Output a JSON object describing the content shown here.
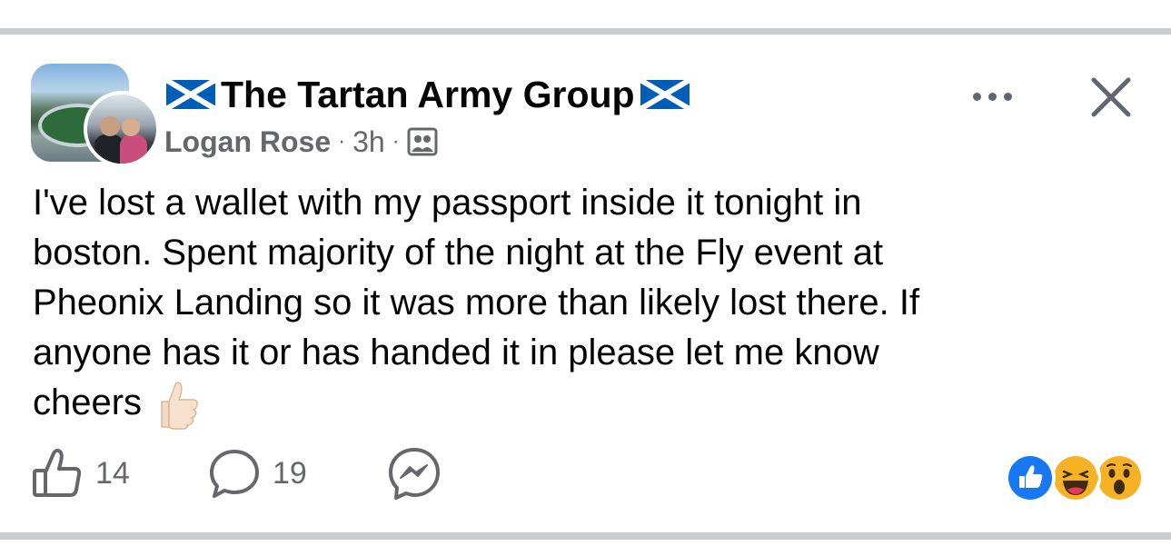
{
  "post": {
    "group_name": "The Tartan Army Group",
    "author": "Logan Rose",
    "time": "3h",
    "separator": "·",
    "text_lines": [
      "I've lost a wallet with my passport inside it tonight in",
      "boston. Spent majority of the night at the Fly event at",
      "Pheonix Landing so it was more than likely lost there. If",
      "anyone has it or has handed it in please let me know",
      "cheers"
    ]
  },
  "actions": {
    "likes": "14",
    "comments": "19"
  },
  "reactions": [
    "like",
    "haha",
    "wow"
  ],
  "icons": {
    "flag": "scotland-flag-icon",
    "audience": "group-members-icon",
    "more": "more-options-icon",
    "close": "close-icon",
    "like": "thumbs-up-outline-icon",
    "comment": "comment-bubble-icon",
    "share": "messenger-icon",
    "emoji": "thumbs-up-emoji"
  },
  "colors": {
    "text": "#050505",
    "secondary": "#65676b",
    "like_blue": "#1877f2",
    "saltire_blue": "#005eb8",
    "separator": "#c9ccd1"
  }
}
